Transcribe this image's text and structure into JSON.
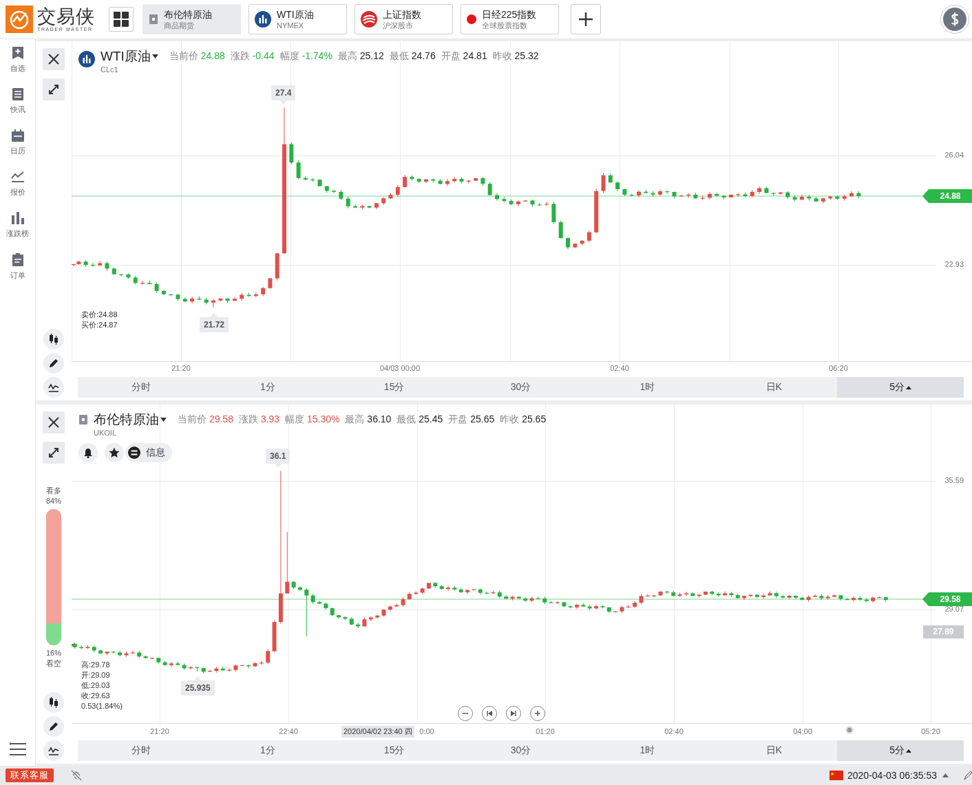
{
  "app": {
    "logo_name": "交易侠",
    "logo_tagline": "TRADER MASTER"
  },
  "tabs": [
    {
      "name": "布伦特原油",
      "sub": "商品期货",
      "kind": "card",
      "selected": true
    },
    {
      "name": "WTI原油",
      "sub": "NYMEX",
      "kind": "bars",
      "selected": false
    },
    {
      "name": "上证指数",
      "sub": "沪深股市",
      "kind": "stock",
      "selected": false
    },
    {
      "name": "日经225指数",
      "sub": "全球股票指数",
      "kind": "dot",
      "selected": false
    }
  ],
  "sidebar": {
    "items": [
      {
        "label": "自选",
        "kind": "bookmark"
      },
      {
        "label": "快讯",
        "kind": "list"
      },
      {
        "label": "日历",
        "kind": "calendar"
      },
      {
        "label": "报价",
        "kind": "trend"
      },
      {
        "label": "涨跌榜",
        "kind": "bars"
      },
      {
        "label": "订单",
        "kind": "clipboard"
      }
    ]
  },
  "panels": [
    {
      "name": "WTI原油",
      "code": "CLc1",
      "kind": "bars",
      "stats": [
        {
          "label": "当前价",
          "value": "24.88",
          "color": "#27b243"
        },
        {
          "label": "涨跌",
          "value": "-0.44",
          "color": "#27b243"
        },
        {
          "label": "幅度",
          "value": "-1.74%",
          "color": "#27b243"
        },
        {
          "label": "最高",
          "value": "25.12",
          "color": "#222222"
        },
        {
          "label": "最低",
          "value": "24.76",
          "color": "#222222"
        },
        {
          "label": "开盘",
          "value": "24.81",
          "color": "#222222"
        },
        {
          "label": "昨收",
          "value": "25.32",
          "color": "#222222"
        }
      ],
      "price_labels": [
        "26.04",
        "22.93"
      ],
      "last_price": "24.88",
      "high_marker": "27.4",
      "low_marker": "21.72",
      "quote_lines": [
        "卖价:24.88",
        "买价:24.87"
      ],
      "time_labels": [
        "21:20",
        "04/03 00:00",
        "02:40",
        "06:20"
      ],
      "intervals": [
        {
          "label": "分时",
          "selected": false,
          "dropdown": false
        },
        {
          "label": "1分",
          "selected": false,
          "dropdown": false
        },
        {
          "label": "15分",
          "selected": false,
          "dropdown": false
        },
        {
          "label": "30分",
          "selected": false,
          "dropdown": false
        },
        {
          "label": "1时",
          "selected": false,
          "dropdown": false
        },
        {
          "label": "日K",
          "selected": false,
          "dropdown": false
        },
        {
          "label": "5分",
          "selected": true,
          "dropdown": true
        }
      ]
    },
    {
      "name": "布伦特原油",
      "code": "UKOIL",
      "kind": "card",
      "stats": [
        {
          "label": "当前价",
          "value": "29.58",
          "color": "#e0504a"
        },
        {
          "label": "涨跌",
          "value": "3.93",
          "color": "#e0504a"
        },
        {
          "label": "幅度",
          "value": "15.30%",
          "color": "#e0504a"
        },
        {
          "label": "最高",
          "value": "36.10",
          "color": "#222222"
        },
        {
          "label": "最低",
          "value": "25.45",
          "color": "#222222"
        },
        {
          "label": "开盘",
          "value": "25.65",
          "color": "#222222"
        },
        {
          "label": "昨收",
          "value": "25.65",
          "color": "#222222"
        }
      ],
      "actions": {
        "info_label": "信息"
      },
      "sentiment": {
        "bull_label": "看多",
        "bull_pct": "84%",
        "bear_pct": "16%",
        "bear_label": "看空",
        "level": 0.84
      },
      "price_labels": [
        "35.59",
        "29.07"
      ],
      "last_price": "29.58",
      "prev_close_tag": "27.89",
      "high_marker": "36.1",
      "low_marker": "25.935",
      "quote_lines": [
        "高:29.78",
        "开:29.09",
        "低:29.03",
        "收:29.63",
        "0.53(1.84%)"
      ],
      "crosshair_time": "2020/04/02 23:40 四",
      "time_labels": [
        "21:20",
        "22:40",
        "0:00",
        "01:20",
        "02:40",
        "04:00",
        "05:20"
      ],
      "intervals": [
        {
          "label": "分时",
          "selected": false,
          "dropdown": false
        },
        {
          "label": "1分",
          "selected": false,
          "dropdown": false
        },
        {
          "label": "15分",
          "selected": false,
          "dropdown": false
        },
        {
          "label": "30分",
          "selected": false,
          "dropdown": false
        },
        {
          "label": "1时",
          "selected": false,
          "dropdown": false
        },
        {
          "label": "日K",
          "selected": false,
          "dropdown": false
        },
        {
          "label": "5分",
          "selected": true,
          "dropdown": true
        }
      ]
    }
  ],
  "status_bar": {
    "support": "联系客服",
    "datetime": "2020-04-03 06:35:53"
  }
}
